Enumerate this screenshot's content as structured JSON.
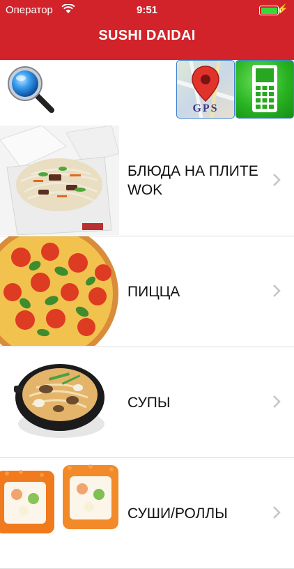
{
  "status_bar": {
    "carrier": "Оператор",
    "time": "9:51"
  },
  "header": {
    "title": "SUSHI DAIDAI",
    "background": "#d2232a"
  },
  "toolbar": {
    "search_icon": "magnifier-icon",
    "gps_label": "GPS",
    "phone_icon": "mobile-phone-icon"
  },
  "menu": {
    "items": [
      {
        "label": "БЛЮДА НА ПЛИТЕ WOK",
        "image": "wok-noodle-box"
      },
      {
        "label": "ПИЦЦА",
        "image": "pizza"
      },
      {
        "label": "СУПЫ",
        "image": "soup-bowl"
      },
      {
        "label": "СУШИ/РОЛЛЫ",
        "image": "sushi-rolls"
      }
    ]
  }
}
